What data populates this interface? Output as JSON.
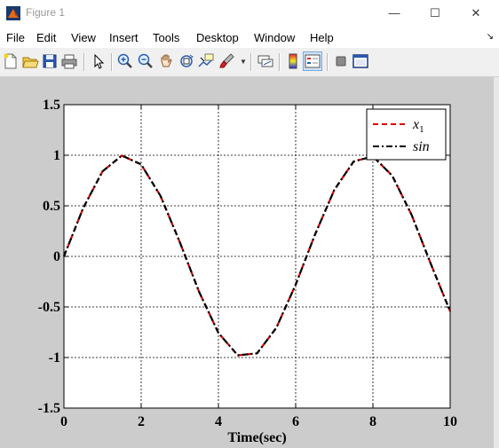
{
  "window": {
    "title": "Figure 1",
    "minimize_icon": "minimize-icon",
    "maximize_icon": "maximize-icon",
    "close_icon": "close-icon"
  },
  "menu": {
    "items": [
      "File",
      "Edit",
      "View",
      "Insert",
      "Tools",
      "Desktop",
      "Window",
      "Help"
    ],
    "overflow_icon": "dock-arrow-icon"
  },
  "toolbar": {
    "buttons": [
      "new-figure-icon",
      "open-file-icon",
      "save-icon",
      "print-icon",
      "pointer-icon",
      "zoom-in-icon",
      "zoom-out-icon",
      "pan-icon",
      "rotate-3d-icon",
      "data-cursor-icon",
      "brush-icon",
      "link-plot-icon",
      "colorbar-icon",
      "legend-icon",
      "hide-plot-tools-icon",
      "show-plot-tools-icon"
    ]
  },
  "colors": {
    "figure_bg": "#cccccc",
    "axes_bg": "#ffffff",
    "series_x1": "#dd0000",
    "series_sin": "#000000"
  },
  "chart_data": {
    "type": "line",
    "title": "",
    "xlabel": "Time(sec)",
    "ylabel": "",
    "xlim": [
      0,
      10
    ],
    "ylim": [
      -1.5,
      1.5
    ],
    "xticks": [
      0,
      2,
      4,
      6,
      8,
      10
    ],
    "yticks": [
      -1.5,
      -1,
      -0.5,
      0,
      0.5,
      1,
      1.5
    ],
    "xtick_labels": [
      "0",
      "2",
      "4",
      "6",
      "8",
      "10"
    ],
    "ytick_labels": [
      "-1.5",
      "-1",
      "-0.5",
      "0",
      "0.5",
      "1",
      "1.5"
    ],
    "grid": true,
    "legend_position": "top-right",
    "x": [
      0,
      0.5,
      1,
      1.5,
      2,
      2.5,
      3,
      3.5,
      4,
      4.5,
      5,
      5.5,
      6,
      6.5,
      7,
      7.5,
      8,
      8.5,
      9,
      9.5,
      10
    ],
    "series": [
      {
        "name": "x_1",
        "color": "#dd0000",
        "style": "dashed",
        "values": [
          0,
          0.479,
          0.841,
          0.997,
          0.909,
          0.598,
          0.141,
          -0.351,
          -0.757,
          -0.978,
          -0.959,
          -0.706,
          -0.279,
          0.215,
          0.657,
          0.938,
          0.989,
          0.798,
          0.412,
          -0.075,
          -0.544
        ]
      },
      {
        "name": "sin",
        "color": "#000000",
        "style": "dashdot",
        "values": [
          0,
          0.479,
          0.841,
          0.997,
          0.909,
          0.598,
          0.141,
          -0.351,
          -0.757,
          -0.978,
          -0.959,
          -0.706,
          -0.279,
          0.215,
          0.657,
          0.938,
          0.989,
          0.798,
          0.412,
          -0.075,
          -0.544
        ]
      }
    ]
  }
}
